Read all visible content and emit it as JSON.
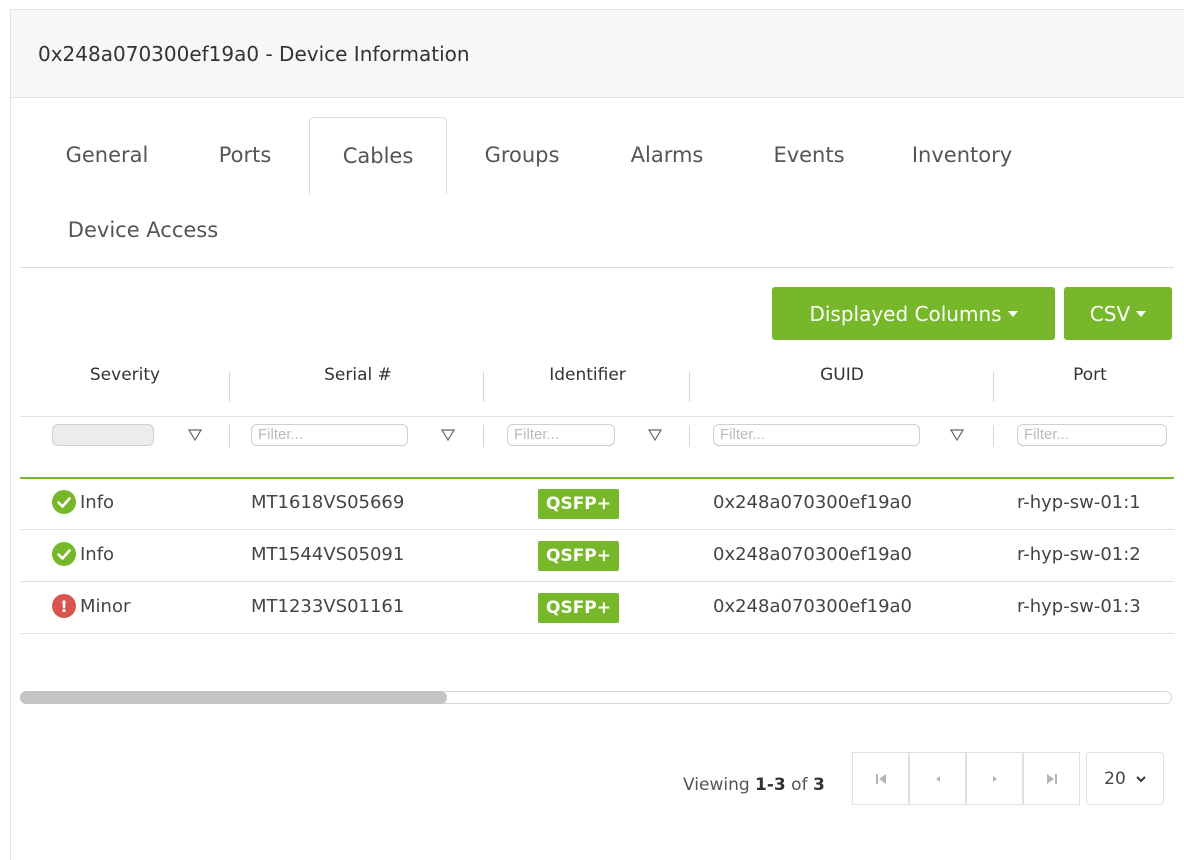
{
  "window": {
    "title": "0x248a070300ef19a0 - Device Information"
  },
  "tabs": [
    {
      "label": "General"
    },
    {
      "label": "Ports"
    },
    {
      "label": "Cables",
      "active": true
    },
    {
      "label": "Groups"
    },
    {
      "label": "Alarms"
    },
    {
      "label": "Events"
    },
    {
      "label": "Inventory"
    },
    {
      "label": "Device Access"
    }
  ],
  "toolbar": {
    "displayed_columns_label": "Displayed Columns",
    "csv_label": "CSV"
  },
  "table": {
    "columns": [
      "Severity",
      "Serial #",
      "Identifier",
      "GUID",
      "Port"
    ],
    "filter_placeholder": "Filter...",
    "rows": [
      {
        "severity": "Info",
        "severity_icon": "check-circle-icon",
        "serial": "MT1618VS05669",
        "identifier": "QSFP+",
        "guid": "0x248a070300ef19a0",
        "port": "r-hyp-sw-01:1"
      },
      {
        "severity": "Info",
        "severity_icon": "check-circle-icon",
        "serial": "MT1544VS05091",
        "identifier": "QSFP+",
        "guid": "0x248a070300ef19a0",
        "port": "r-hyp-sw-01:2"
      },
      {
        "severity": "Minor",
        "severity_icon": "exclamation-circle-icon",
        "serial": "MT1233VS01161",
        "identifier": "QSFP+",
        "guid": "0x248a070300ef19a0",
        "port": "r-hyp-sw-01:3"
      }
    ]
  },
  "pagination": {
    "viewing_prefix": "Viewing",
    "range": "1-3",
    "of_label": "of",
    "total": "3",
    "page_size": "20"
  },
  "colors": {
    "accent": "#76b82a",
    "minor": "#d9534f"
  }
}
